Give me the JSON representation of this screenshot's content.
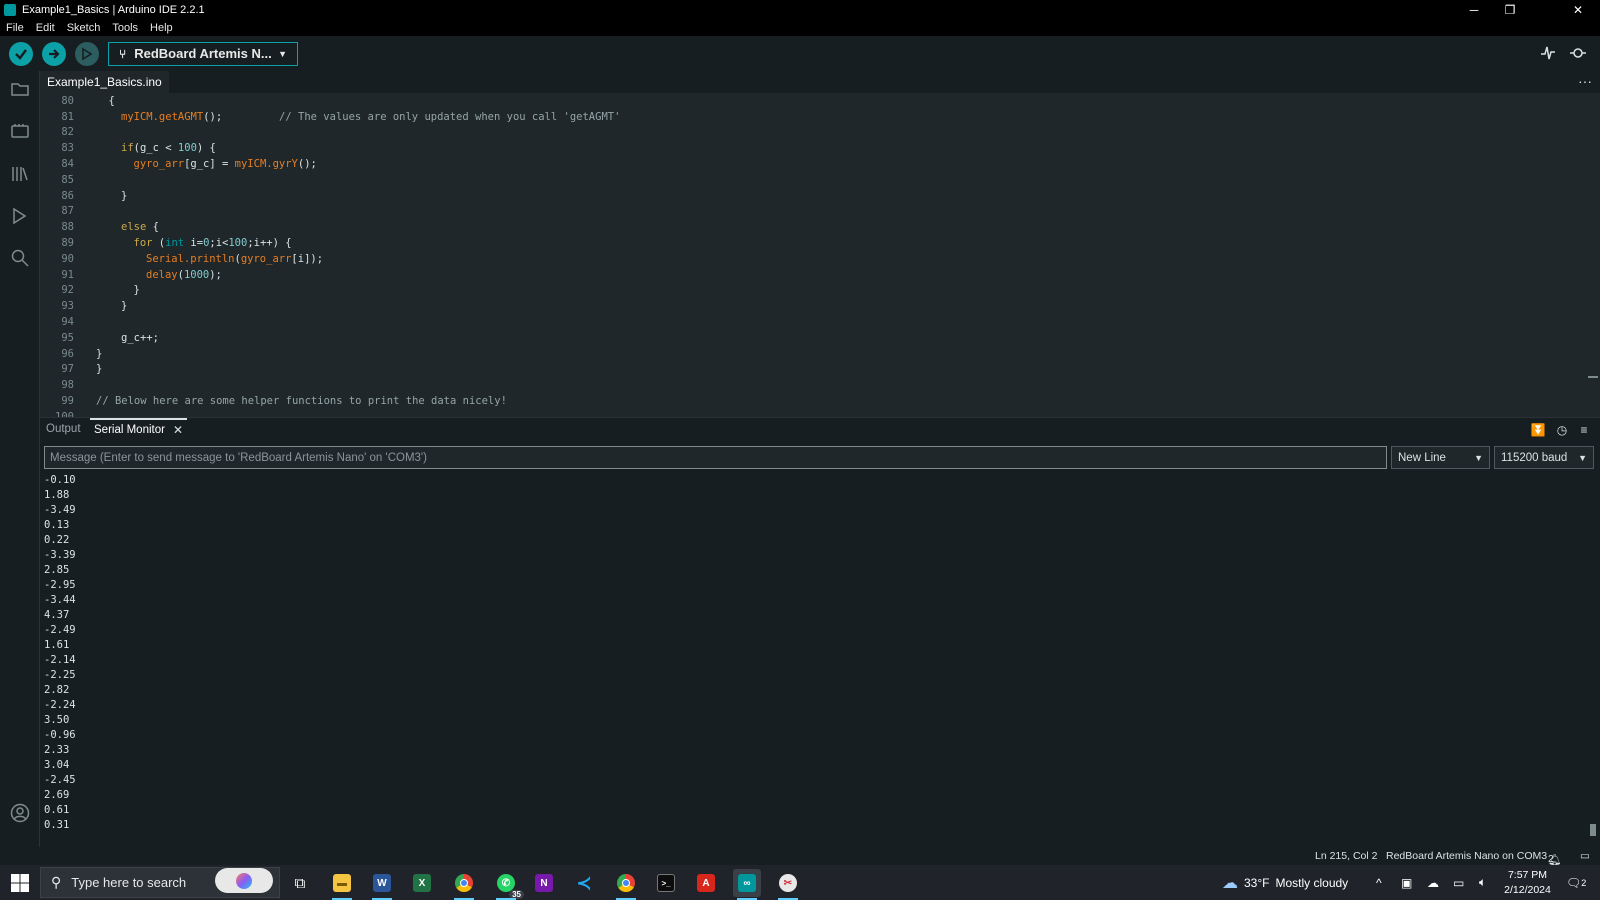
{
  "window": {
    "title": "Example1_Basics | Arduino IDE 2.2.1",
    "controls": {
      "minimize": "─",
      "restore": "❐",
      "close": "✕"
    }
  },
  "menu": [
    "File",
    "Edit",
    "Sketch",
    "Tools",
    "Help"
  ],
  "toolbar": {
    "board_label": "RedBoard Artemis N...",
    "verify_icon": "check-icon",
    "upload_icon": "arrow-right-icon",
    "debug_icon": "debug-icon"
  },
  "tab": {
    "file_name": "Example1_Basics.ino",
    "more": "···"
  },
  "editor": {
    "lines": [
      {
        "n": "80",
        "indent": 1,
        "segs": [
          [
            "p",
            "{"
          ]
        ]
      },
      {
        "n": "81",
        "indent": 2,
        "segs": [
          [
            "fn",
            "myICM.getAGMT"
          ],
          [
            "p",
            "();         "
          ],
          [
            "cm",
            "// The values are only updated when you call 'getAGMT'"
          ]
        ]
      },
      {
        "n": "82",
        "indent": 0,
        "segs": []
      },
      {
        "n": "83",
        "indent": 2,
        "segs": [
          [
            "kw",
            "if"
          ],
          [
            "p",
            "(g_c < "
          ],
          [
            "num",
            "100"
          ],
          [
            "p",
            ") {"
          ]
        ]
      },
      {
        "n": "84",
        "indent": 3,
        "segs": [
          [
            "fn",
            "gyro_arr"
          ],
          [
            "p",
            "[g_c] = "
          ],
          [
            "fn",
            "myICM.gyrY"
          ],
          [
            "p",
            "();"
          ]
        ]
      },
      {
        "n": "85",
        "indent": 0,
        "segs": []
      },
      {
        "n": "86",
        "indent": 2,
        "segs": [
          [
            "p",
            "}"
          ]
        ]
      },
      {
        "n": "87",
        "indent": 0,
        "segs": []
      },
      {
        "n": "88",
        "indent": 2,
        "segs": [
          [
            "kw",
            "else"
          ],
          [
            "p",
            " {"
          ]
        ]
      },
      {
        "n": "89",
        "indent": 3,
        "segs": [
          [
            "kw",
            "for"
          ],
          [
            "p",
            " ("
          ],
          [
            "ty",
            "int"
          ],
          [
            "p",
            " i="
          ],
          [
            "num",
            "0"
          ],
          [
            "p",
            ";i<"
          ],
          [
            "num",
            "100"
          ],
          [
            "p",
            ";i++) {"
          ]
        ]
      },
      {
        "n": "90",
        "indent": 4,
        "segs": [
          [
            "fn",
            "Serial.println"
          ],
          [
            "p",
            "("
          ],
          [
            "fn",
            "gyro_arr"
          ],
          [
            "p",
            "[i]);"
          ]
        ]
      },
      {
        "n": "91",
        "indent": 4,
        "segs": [
          [
            "fn",
            "delay"
          ],
          [
            "p",
            "("
          ],
          [
            "num",
            "1000"
          ],
          [
            "p",
            ");"
          ]
        ]
      },
      {
        "n": "92",
        "indent": 3,
        "segs": [
          [
            "p",
            "}"
          ]
        ]
      },
      {
        "n": "93",
        "indent": 2,
        "segs": [
          [
            "p",
            "}"
          ]
        ]
      },
      {
        "n": "94",
        "indent": 0,
        "segs": []
      },
      {
        "n": "95",
        "indent": 2,
        "segs": [
          [
            "p",
            "g_c++;"
          ]
        ]
      },
      {
        "n": "96",
        "indent": 0,
        "segs": [
          [
            "p",
            "}"
          ]
        ]
      },
      {
        "n": "97",
        "indent": 0,
        "segs": [
          [
            "p",
            "}"
          ]
        ]
      },
      {
        "n": "98",
        "indent": 0,
        "segs": []
      },
      {
        "n": "99",
        "indent": 0,
        "segs": [
          [
            "cm",
            "// Below here are some helper functions to print the data nicely!"
          ]
        ]
      },
      {
        "n": "100",
        "indent": 0,
        "segs": []
      }
    ]
  },
  "panel": {
    "tabs": [
      "Output",
      "Serial Monitor"
    ],
    "close": "✕",
    "message_placeholder": "Message (Enter to send message to 'RedBoard Artemis Nano' on 'COM3')",
    "line_ending": "New Line",
    "baud": "115200 baud"
  },
  "serial_output": [
    "-0.10",
    "1.88",
    "-3.49",
    "0.13",
    "0.22",
    "-3.39",
    "2.85",
    "-2.95",
    "-3.44",
    "4.37",
    "-2.49",
    "1.61",
    "-2.14",
    "-2.25",
    "2.82",
    "-2.24",
    "3.50",
    "-0.96",
    "2.33",
    "3.04",
    "-2.45",
    "2.69",
    "0.61",
    "0.31"
  ],
  "status": {
    "position": "Ln 215, Col 2",
    "board": "RedBoard Artemis Nano on COM3",
    "notifications": "2"
  },
  "taskbar": {
    "search_placeholder": "Type here to search",
    "weather_temp": "33°F",
    "weather_text": "Mostly cloudy",
    "time": "7:57 PM",
    "date": "2/12/2024",
    "whatsapp_badge": "35",
    "notif_count": "2"
  },
  "colors": {
    "accent": "#0ca1a6",
    "editor_bg": "#1f272a",
    "bg": "#171e21"
  }
}
